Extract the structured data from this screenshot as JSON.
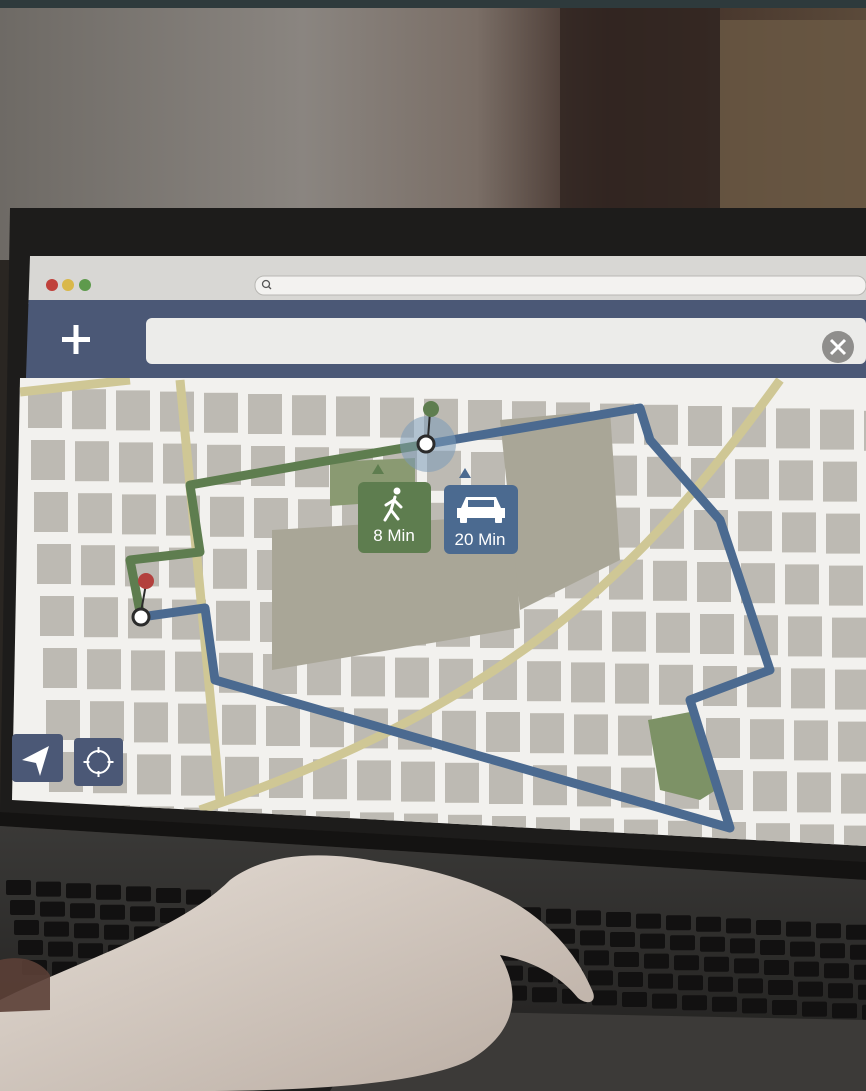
{
  "browser": {
    "window_controls": [
      "close",
      "minimize",
      "maximize"
    ],
    "address_bar": {
      "value": "",
      "icon": "search-icon"
    }
  },
  "map_app": {
    "add_button": {
      "icon": "plus-icon"
    },
    "search_input": {
      "value": "",
      "placeholder": ""
    },
    "clear_button": {
      "icon": "close-icon"
    },
    "route_options": {
      "walk": {
        "icon": "walking-person-icon",
        "label": "8 Min",
        "color": "#5e7d4f"
      },
      "car": {
        "icon": "car-icon",
        "label": "20 Min",
        "color": "#4b6a90"
      }
    },
    "map_controls": [
      {
        "icon": "navigation-arrow-icon"
      },
      {
        "icon": "crosshair-icon"
      }
    ],
    "markers": {
      "origin": {
        "color": "#b3403d"
      },
      "destination": {
        "color": "#5e7d4f"
      }
    }
  },
  "colors": {
    "walk_route": "#5e7d4f",
    "drive_route": "#4b6a90",
    "road": "#f2f1ee",
    "block": "#bdbab3",
    "park": "#8a9a72",
    "highway": "#cfc795"
  }
}
